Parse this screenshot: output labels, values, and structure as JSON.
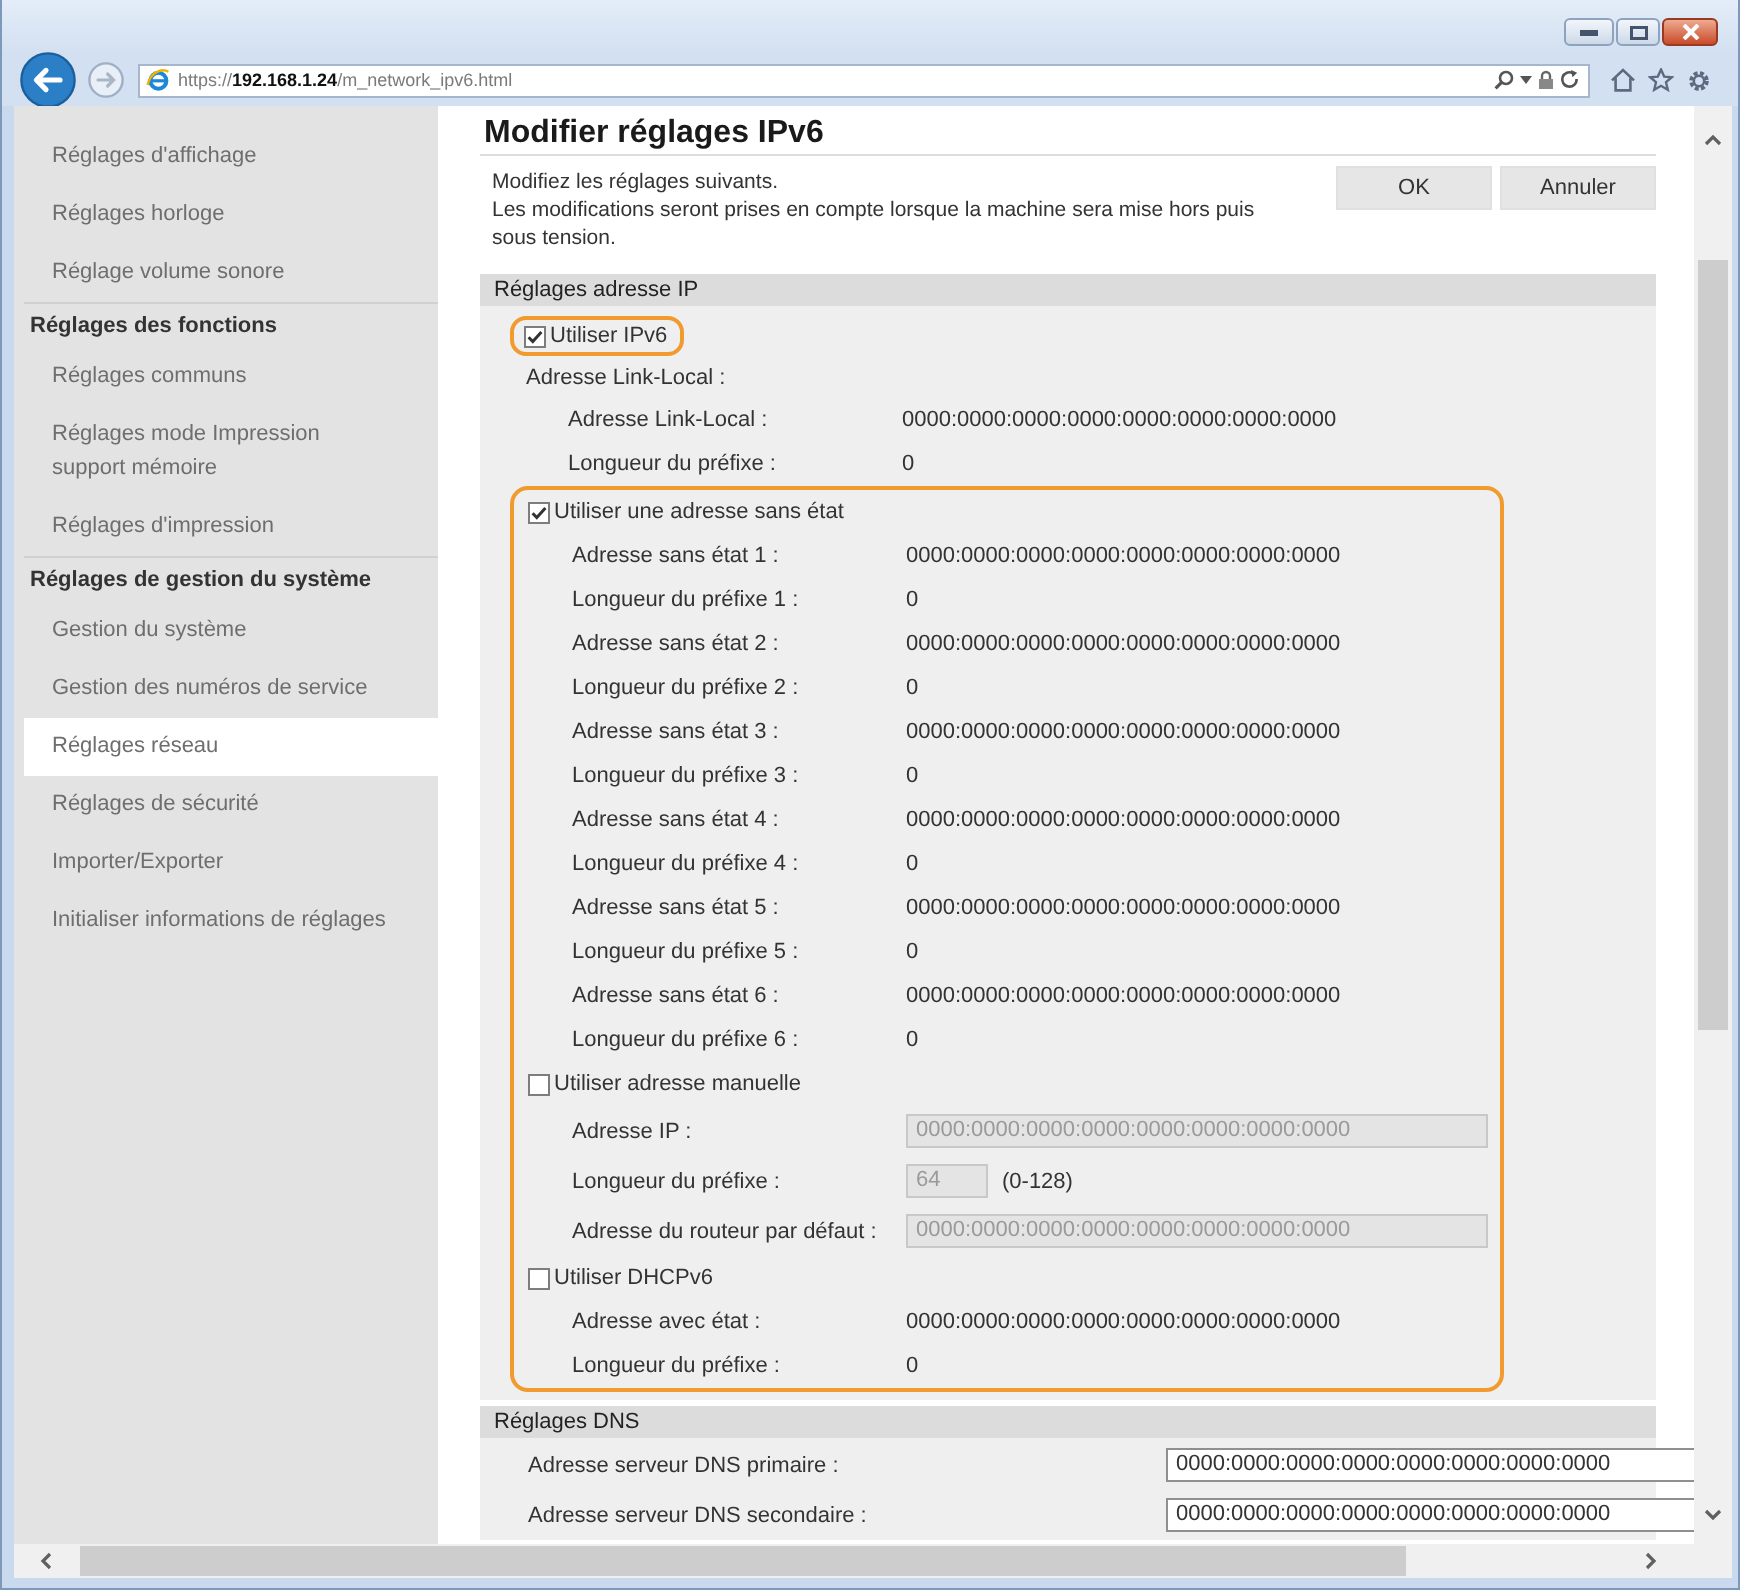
{
  "browser": {
    "url": "https://**192.168.1.24**/m_network_ipv6.html"
  },
  "sidebar": {
    "groups": [
      {
        "items": [
          {
            "label": "Réglages d'affichage",
            "selected": false
          },
          {
            "label": "Réglages horloge",
            "selected": false
          },
          {
            "label": "Réglage volume sonore",
            "selected": false
          }
        ]
      },
      {
        "title": "Réglages des fonctions",
        "items": [
          {
            "label": "Réglages communs",
            "selected": false
          },
          {
            "label": "Réglages mode Impression\nsupport mémoire",
            "selected": false
          },
          {
            "label": "Réglages d'impression",
            "selected": false
          }
        ]
      },
      {
        "title": "Réglages de gestion du système",
        "items": [
          {
            "label": "Gestion du système",
            "selected": false
          },
          {
            "label": "Gestion des numéros de service",
            "selected": false
          },
          {
            "label": "Réglages réseau",
            "selected": true
          },
          {
            "label": "Réglages de sécurité",
            "selected": false
          },
          {
            "label": "Importer/Exporter",
            "selected": false
          },
          {
            "label": "Initialiser informations de réglages",
            "selected": false
          }
        ]
      }
    ]
  },
  "page": {
    "title": "Modifier réglages IPv6",
    "intro": [
      "Modifiez les réglages suivants.",
      "Les modifications seront prises en compte lorsque la machine sera mise hors puis\nsous tension."
    ],
    "buttons": [
      "OK",
      "Annuler"
    ]
  },
  "sections": [
    {
      "title": "Réglages adresse IP",
      "items": [
        {
          "kind": "checkbox",
          "label": "Utiliser IPv6",
          "checked": true,
          "highlighted": true
        },
        {
          "kind": "heading",
          "label": "Adresse Link-Local :",
          "children": [
            {
              "kind": "value",
              "label": "Adresse Link-Local :",
              "value": "0000:0000:0000:0000:0000:0000:0000:0000"
            },
            {
              "kind": "value",
              "label": "Longueur du préfixe :",
              "value": "0"
            }
          ]
        },
        {
          "kind": "frame",
          "highlighted": true,
          "children": [
            {
              "kind": "checkbox",
              "label": "Utiliser une adresse sans état",
              "checked": true,
              "children": [
                {
                  "kind": "value",
                  "label": "Adresse sans état 1 :",
                  "value": "0000:0000:0000:0000:0000:0000:0000:0000"
                },
                {
                  "kind": "value",
                  "label": "Longueur du préfixe 1 :",
                  "value": "0"
                },
                {
                  "kind": "value",
                  "label": "Adresse sans état 2 :",
                  "value": "0000:0000:0000:0000:0000:0000:0000:0000"
                },
                {
                  "kind": "value",
                  "label": "Longueur du préfixe 2 :",
                  "value": "0"
                },
                {
                  "kind": "value",
                  "label": "Adresse sans état 3 :",
                  "value": "0000:0000:0000:0000:0000:0000:0000:0000"
                },
                {
                  "kind": "value",
                  "label": "Longueur du préfixe 3 :",
                  "value": "0"
                },
                {
                  "kind": "value",
                  "label": "Adresse sans état 4 :",
                  "value": "0000:0000:0000:0000:0000:0000:0000:0000"
                },
                {
                  "kind": "value",
                  "label": "Longueur du préfixe 4 :",
                  "value": "0"
                },
                {
                  "kind": "value",
                  "label": "Adresse sans état 5 :",
                  "value": "0000:0000:0000:0000:0000:0000:0000:0000"
                },
                {
                  "kind": "value",
                  "label": "Longueur du préfixe 5 :",
                  "value": "0"
                },
                {
                  "kind": "value",
                  "label": "Adresse sans état 6 :",
                  "value": "0000:0000:0000:0000:0000:0000:0000:0000"
                },
                {
                  "kind": "value",
                  "label": "Longueur du préfixe 6 :",
                  "value": "0"
                }
              ]
            },
            {
              "kind": "checkbox",
              "label": "Utiliser adresse manuelle",
              "checked": false,
              "children": [
                {
                  "kind": "input",
                  "label": "Adresse IP :",
                  "value": "0000:0000:0000:0000:0000:0000:0000:0000",
                  "disabled": true
                },
                {
                  "kind": "number_input",
                  "label": "Longueur du préfixe :",
                  "value": "64",
                  "range": "(0-128)",
                  "disabled": true
                },
                {
                  "kind": "input",
                  "label": "Adresse du routeur par défaut :",
                  "value": "0000:0000:0000:0000:0000:0000:0000:0000",
                  "disabled": true
                }
              ]
            },
            {
              "kind": "checkbox",
              "label": "Utiliser DHCPv6",
              "checked": false,
              "children": [
                {
                  "kind": "value",
                  "label": "Adresse avec état :",
                  "value": "0000:0000:0000:0000:0000:0000:0000:0000"
                },
                {
                  "kind": "value",
                  "label": "Longueur du préfixe :",
                  "value": "0"
                }
              ]
            }
          ]
        }
      ]
    },
    {
      "title": "Réglages DNS",
      "items": [
        {
          "kind": "input",
          "label": "Adresse serveur DNS primaire :",
          "value": "0000:0000:0000:0000:0000:0000:0000:0000",
          "disabled": false
        },
        {
          "kind": "input",
          "label": "Adresse serveur DNS secondaire :",
          "value": "0000:0000:0000:0000:0000:0000:0000:0000",
          "disabled": false
        }
      ]
    }
  ]
}
